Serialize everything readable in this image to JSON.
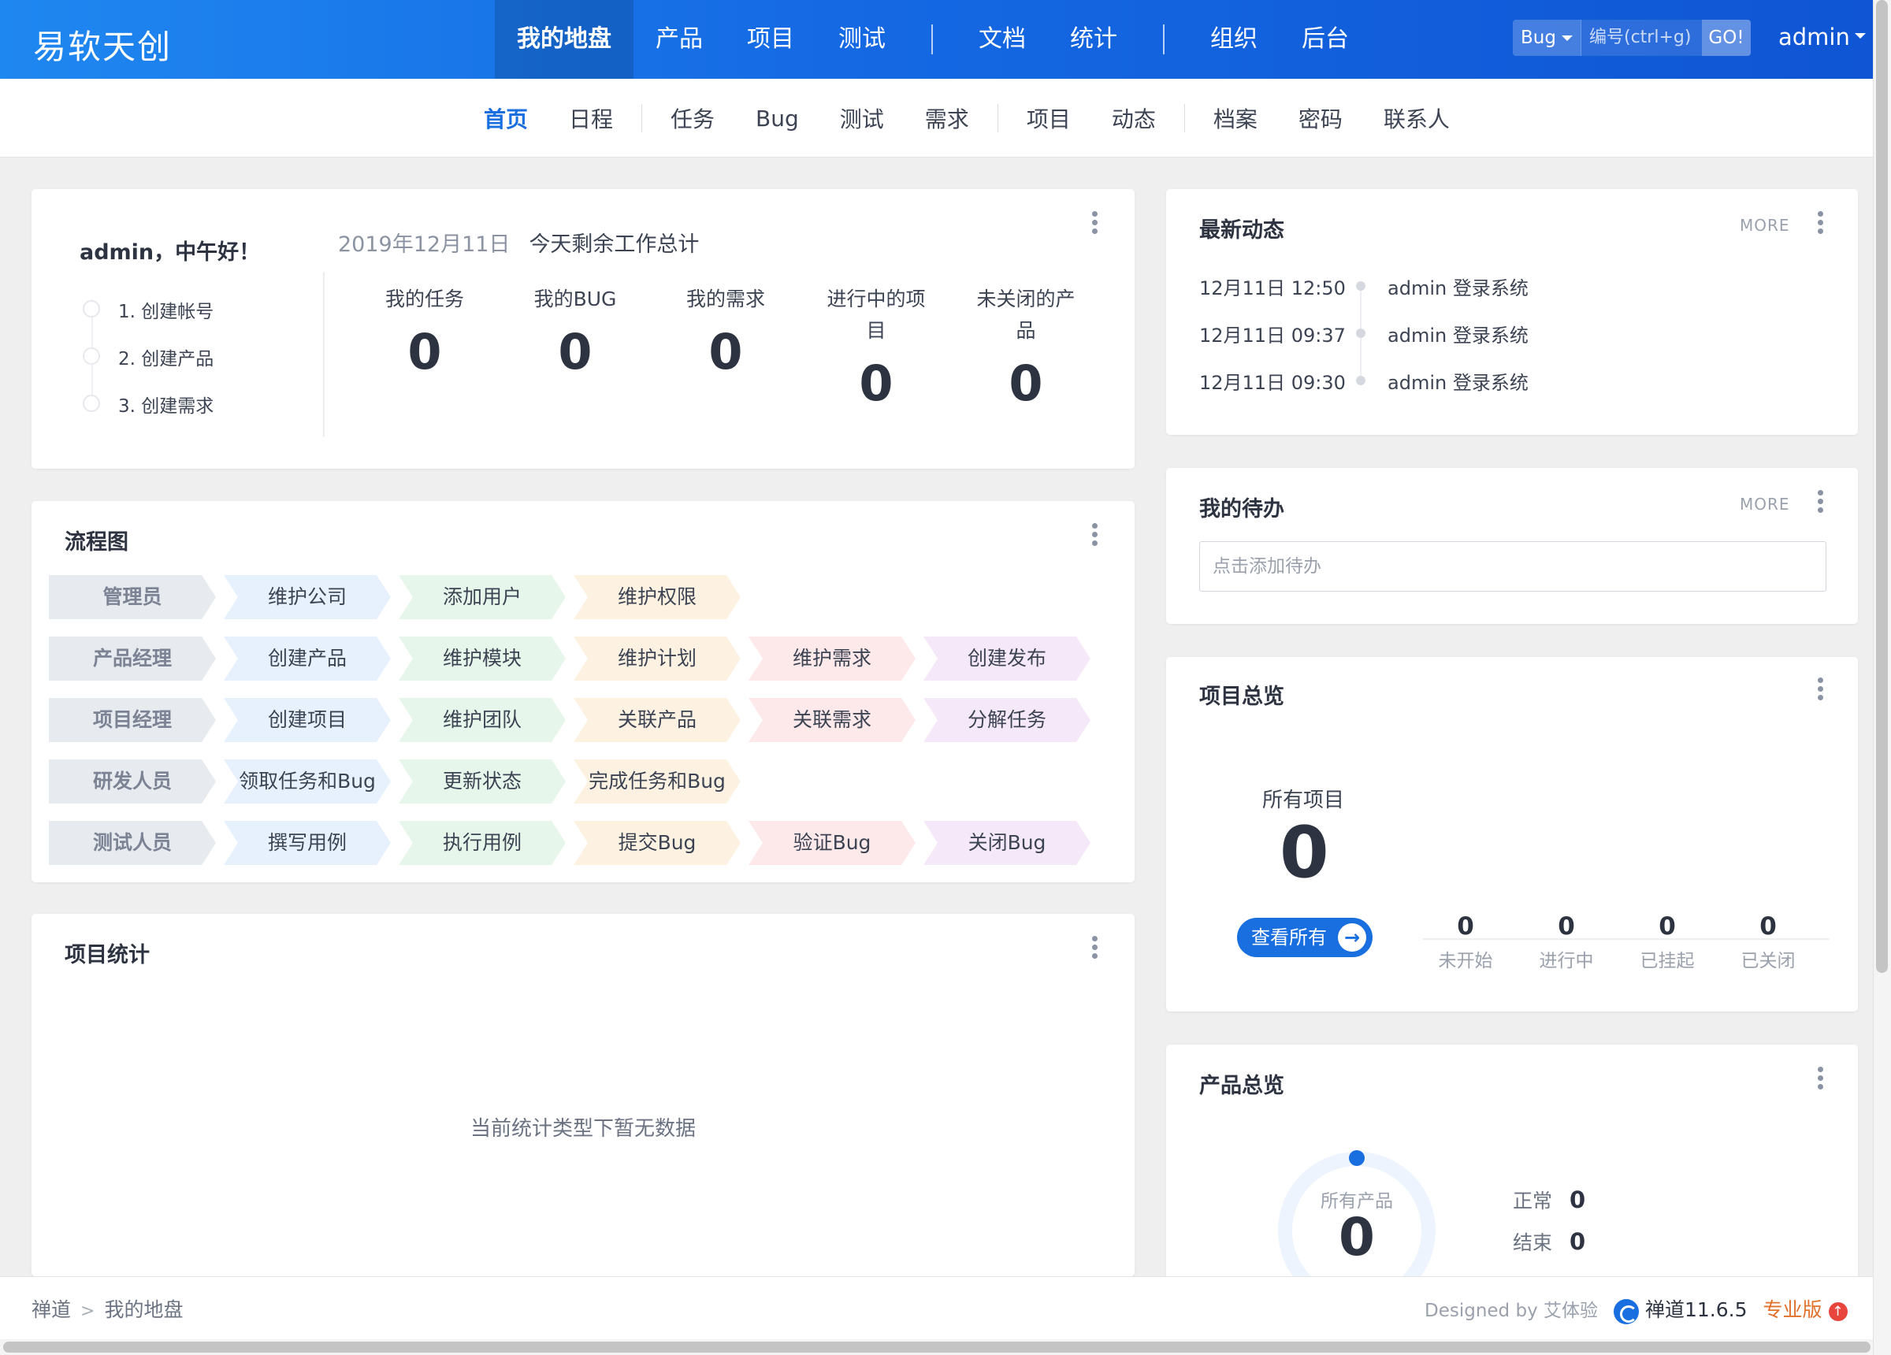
{
  "app": {
    "logo": "易软天创"
  },
  "mainnav": [
    "我的地盘",
    "产品",
    "项目",
    "测试",
    "文档",
    "统计",
    "组织",
    "后台"
  ],
  "search": {
    "type": "Bug",
    "placeholder": "编号(ctrl+g)",
    "go": "GO!"
  },
  "user": "admin",
  "subnav": [
    "首页",
    "日程",
    "任务",
    "Bug",
    "测试",
    "需求",
    "项目",
    "动态",
    "档案",
    "密码",
    "联系人"
  ],
  "welcome": {
    "greeting": "admin，中午好！",
    "steps": [
      "1. 创建帐号",
      "2. 创建产品",
      "3. 创建需求"
    ],
    "date": "2019年12月11日",
    "today_label": "今天剩余工作总计",
    "stats": [
      {
        "label": "我的任务",
        "value": "0"
      },
      {
        "label": "我的BUG",
        "value": "0"
      },
      {
        "label": "我的需求",
        "value": "0"
      },
      {
        "label": "进行中的项目",
        "value": "0"
      },
      {
        "label": "未关闭的产品",
        "value": "0"
      }
    ]
  },
  "flow": {
    "title": "流程图",
    "rows": [
      {
        "role": "管理员",
        "steps": [
          "维护公司",
          "添加用户",
          "维护权限"
        ]
      },
      {
        "role": "产品经理",
        "steps": [
          "创建产品",
          "维护模块",
          "维护计划",
          "维护需求",
          "创建发布"
        ]
      },
      {
        "role": "项目经理",
        "steps": [
          "创建项目",
          "维护团队",
          "关联产品",
          "关联需求",
          "分解任务"
        ]
      },
      {
        "role": "研发人员",
        "steps": [
          "领取任务和Bug",
          "更新状态",
          "完成任务和Bug"
        ]
      },
      {
        "role": "测试人员",
        "steps": [
          "撰写用例",
          "执行用例",
          "提交Bug",
          "验证Bug",
          "关闭Bug"
        ]
      }
    ]
  },
  "projstats": {
    "title": "项目统计",
    "empty": "当前统计类型下暂无数据"
  },
  "dynamic": {
    "title": "最新动态",
    "more": "MORE",
    "items": [
      {
        "time": "12月11日 12:50",
        "text": "admin 登录系统"
      },
      {
        "time": "12月11日 09:37",
        "text": "admin 登录系统"
      },
      {
        "time": "12月11日 09:30",
        "text": "admin 登录系统"
      }
    ]
  },
  "todo": {
    "title": "我的待办",
    "more": "MORE",
    "placeholder": "点击添加待办"
  },
  "projoverview": {
    "title": "项目总览",
    "all_label": "所有项目",
    "all_value": "0",
    "view_all": "查看所有",
    "stats": [
      {
        "label": "未开始",
        "value": "0"
      },
      {
        "label": "进行中",
        "value": "0"
      },
      {
        "label": "已挂起",
        "value": "0"
      },
      {
        "label": "已关闭",
        "value": "0"
      }
    ]
  },
  "prodoverview": {
    "title": "产品总览",
    "all_label": "所有产品",
    "all_value": "0",
    "normal_label": "正常",
    "normal_value": "0",
    "closed_label": "结束",
    "closed_value": "0"
  },
  "footer": {
    "crumb_home": "禅道",
    "crumb_sep": ">",
    "crumb_current": "我的地盘",
    "designed_by": "Designed by 艾体验",
    "version": "禅道11.6.5",
    "edition": "专业版"
  },
  "colors": {
    "primary": "#1a6fe0",
    "topbar": "#1569e3",
    "edition": "#e0702a"
  }
}
